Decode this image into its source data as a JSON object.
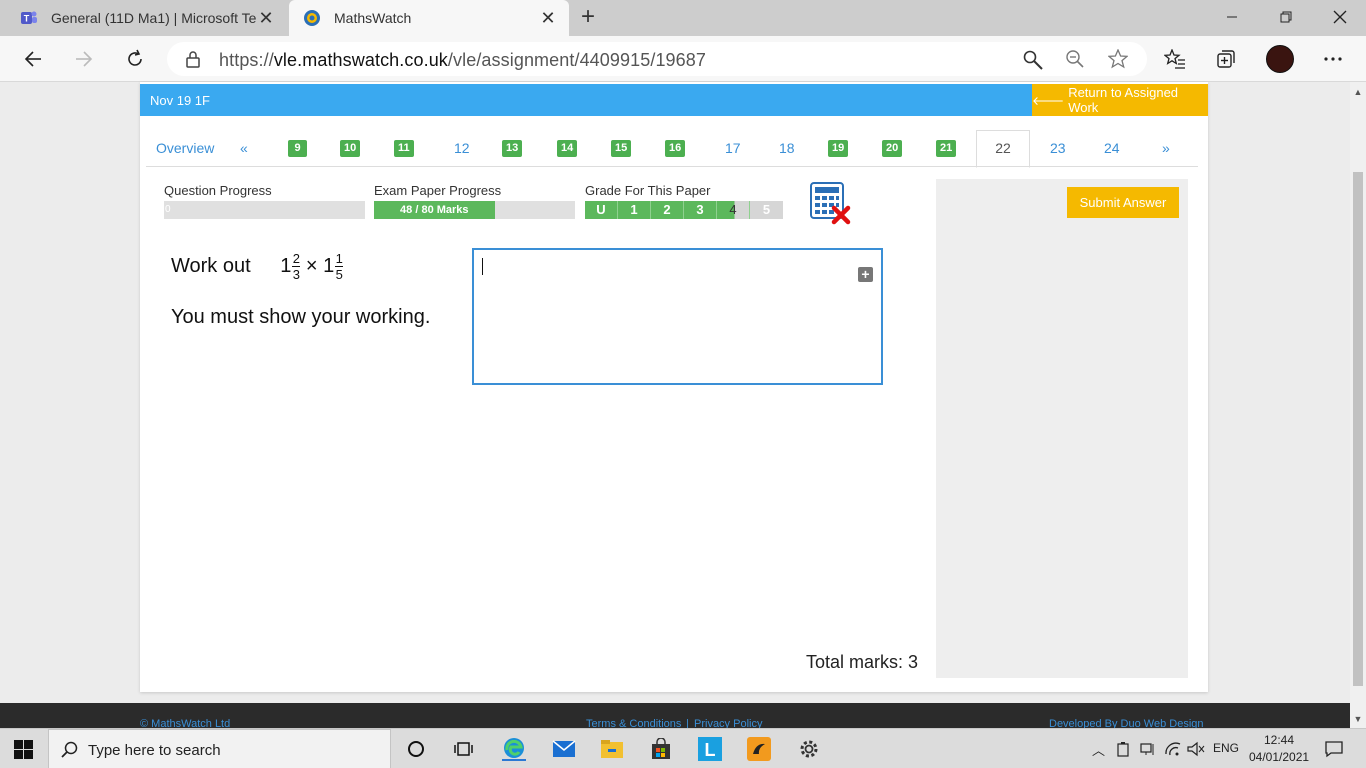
{
  "browser": {
    "tabs": [
      {
        "title": "General (11D Ma1) | Microsoft Te",
        "icon": "teams-icon"
      },
      {
        "title": "MathsWatch",
        "icon": "mathswatch-icon"
      }
    ],
    "url": {
      "prefix": "https://",
      "host": "vle.mathswatch.co.uk",
      "path": "/vle/assignment/4409915/19687"
    }
  },
  "page": {
    "paper_name": "Nov 19 1F",
    "return_label": "Return to Assigned Work",
    "nav": {
      "overview": "Overview",
      "prev": "«",
      "next": "»",
      "questions": [
        {
          "n": "9",
          "done": true
        },
        {
          "n": "10",
          "done": true
        },
        {
          "n": "11",
          "done": true
        },
        {
          "n": "12",
          "done": false
        },
        {
          "n": "13",
          "done": true
        },
        {
          "n": "14",
          "done": true
        },
        {
          "n": "15",
          "done": true
        },
        {
          "n": "16",
          "done": true
        },
        {
          "n": "17",
          "done": false
        },
        {
          "n": "18",
          "done": false
        },
        {
          "n": "19",
          "done": true
        },
        {
          "n": "20",
          "done": true
        },
        {
          "n": "21",
          "done": true
        },
        {
          "n": "22",
          "current": true
        },
        {
          "n": "23",
          "done": false
        },
        {
          "n": "24",
          "done": false
        }
      ]
    },
    "progress": {
      "question_label": "Question Progress",
      "question_value": "0",
      "question_fraction": 0.0,
      "exam_label": "Exam Paper Progress",
      "exam_value": "48 / 80 Marks",
      "exam_fraction": 0.6,
      "grade_label": "Grade For This Paper",
      "grades": [
        "U",
        "1",
        "2",
        "3",
        "4",
        "5"
      ],
      "grade_achieved": 4,
      "grade_partial_fraction": 0.55
    },
    "calculator": {
      "icon": "calculator-not-allowed-icon"
    },
    "question": {
      "prefix": "Work out",
      "whole1": "1",
      "num1": "2",
      "den1": "3",
      "operator": "×",
      "whole2": "1",
      "num2": "1",
      "den2": "5",
      "instruction": "You must show your working."
    },
    "answer": {
      "value": "",
      "expand_icon": "expand-plus-icon"
    },
    "total_marks": "Total marks: 3",
    "submit_label": "Submit Answer",
    "footer": {
      "left": "© MathsWatch Ltd",
      "terms": "Terms & Conditions",
      "separator": "|",
      "privacy": "Privacy Policy",
      "right": "Developed By Duo Web Design"
    }
  },
  "taskbar": {
    "search_placeholder": "Type here to search",
    "language": "ENG",
    "time": "12:44",
    "date": "04/01/2021"
  },
  "colors": {
    "header_blue": "#3aa9f0",
    "accent_yellow": "#f5b900",
    "done_green": "#4caf50",
    "link_blue": "#3a8fd6"
  }
}
